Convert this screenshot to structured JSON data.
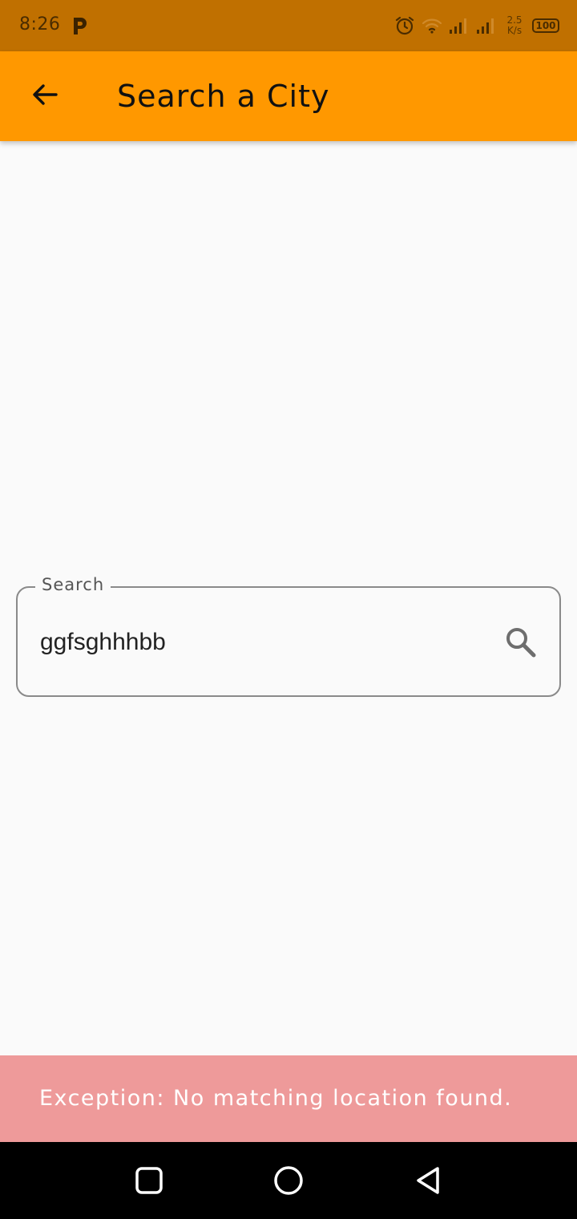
{
  "status_bar": {
    "time": "8:26",
    "net_speed_value": "2.5",
    "net_speed_unit": "K/s",
    "battery": "100",
    "icons": [
      "parking-app-icon",
      "alarm-icon",
      "wifi-icon",
      "signal-icon-1",
      "signal-icon-2",
      "battery-icon"
    ]
  },
  "app_bar": {
    "title": "Search a City",
    "back_icon": "arrow-back-icon",
    "color": "#ff9800"
  },
  "search": {
    "label": "Search",
    "value": "ggfsghhhbb",
    "icon": "search-icon"
  },
  "snackbar": {
    "message": "Exception: No matching location found.",
    "color": "#ee9a9a"
  },
  "nav_bar": {
    "buttons": [
      "recents-square-icon",
      "home-circle-icon",
      "back-triangle-icon"
    ]
  }
}
